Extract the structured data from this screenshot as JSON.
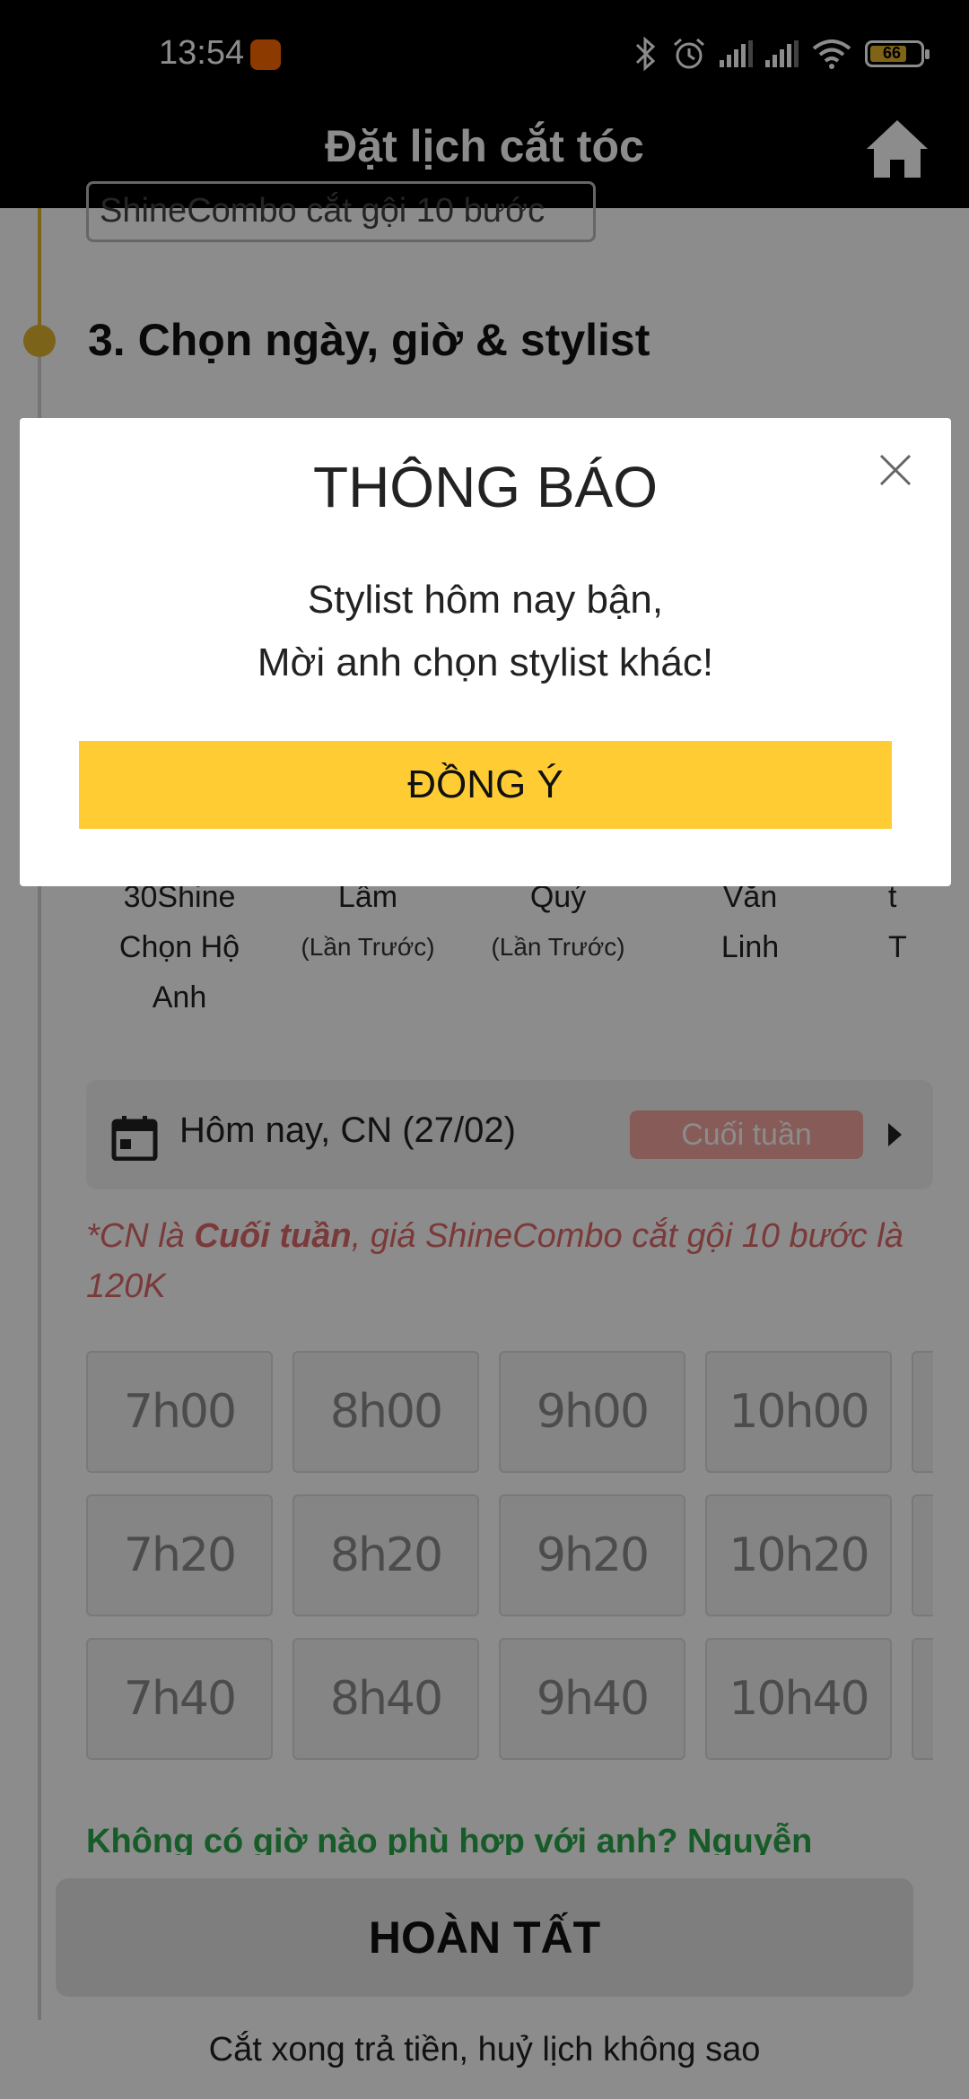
{
  "status_bar": {
    "time": "13:54",
    "battery": "66"
  },
  "app_bar": {
    "title": "Đặt lịch cắt tóc"
  },
  "service": {
    "selected": "ShineCombo cắt gội 10 bước"
  },
  "step": {
    "title": "3. Chọn ngày, giờ & stylist"
  },
  "stylists": [
    {
      "line1": "30Shine",
      "line2": "Chọn Hộ",
      "line3": "Anh"
    },
    {
      "line1": "Lâm",
      "line2": "(Lần Trước)"
    },
    {
      "line1": "Quý",
      "line2": "(Lần Trước)"
    },
    {
      "line1": "Văn",
      "line2": "Linh"
    },
    {
      "line1": "t",
      "line2": "T"
    }
  ],
  "date_selector": {
    "label": "Hôm nay, CN (27/02)",
    "badge": "Cuối tuần"
  },
  "note": {
    "prefix": "*CN là ",
    "bold": "Cuối tuần",
    "suffix": ", giá ShineCombo cắt gội 10 bước là 120K"
  },
  "time_slots": [
    [
      "7h00",
      "8h00",
      "9h00",
      "10h00",
      ""
    ],
    [
      "7h20",
      "8h20",
      "9h20",
      "10h20",
      ""
    ],
    [
      "7h40",
      "8h40",
      "9h40",
      "10h40",
      ""
    ]
  ],
  "suggest_text": "Không có giờ nào phù hợp với anh? Nguyễn",
  "finish_button": "HOÀN TẤT",
  "footer_note": "Cắt xong trả tiền, huỷ lịch không sao",
  "modal": {
    "title": "THÔNG BÁO",
    "message_line1": "Stylist hôm nay bận,",
    "message_line2": "Mời anh chọn stylist khác!",
    "confirm_label": "ĐỒNG Ý"
  },
  "colors": {
    "accent": "#ffcc33",
    "timeline": "#e0b531",
    "weekend": "#e06a6a",
    "suggest": "#2aa84a"
  }
}
